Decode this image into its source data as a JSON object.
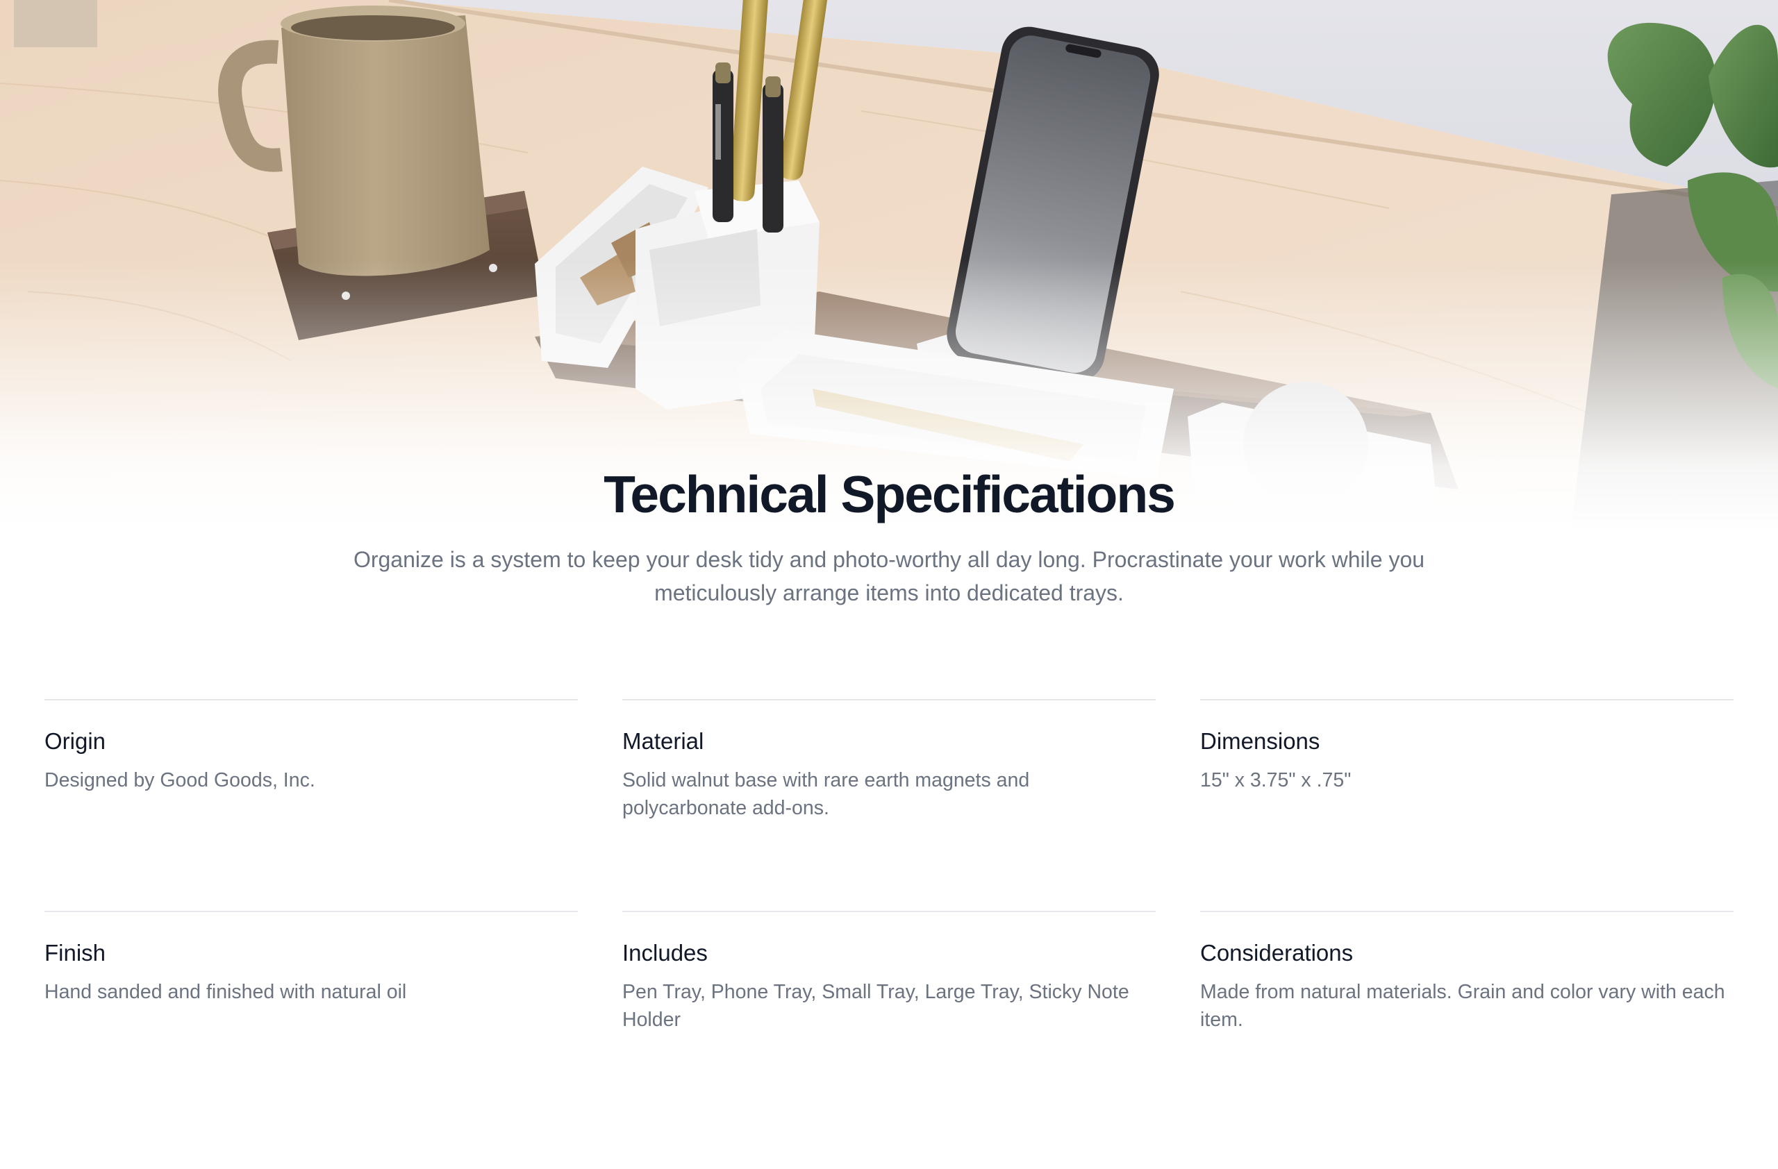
{
  "hero": {
    "image_subject": "desk-organizer-photo"
  },
  "intro": {
    "title": "Technical Specifications",
    "lead": "Organize is a system to keep your desk tidy and photo-worthy all day long. Procrastinate your work while you meticulously arrange items into dedicated trays."
  },
  "specs": [
    {
      "term": "Origin",
      "description": "Designed by Good Goods, Inc."
    },
    {
      "term": "Material",
      "description": "Solid walnut base with rare earth magnets and polycarbonate add-ons."
    },
    {
      "term": "Dimensions",
      "description": "15\" x 3.75\" x .75\""
    },
    {
      "term": "Finish",
      "description": "Hand sanded and finished with natural oil"
    },
    {
      "term": "Includes",
      "description": "Pen Tray, Phone Tray, Small Tray, Large Tray, Sticky Note Holder"
    },
    {
      "term": "Considerations",
      "description": "Made from natural materials. Grain and color vary with each item."
    }
  ],
  "colors": {
    "heading": "#111827",
    "body": "#6b7280",
    "divider": "#e5e7eb",
    "background": "#ffffff"
  }
}
